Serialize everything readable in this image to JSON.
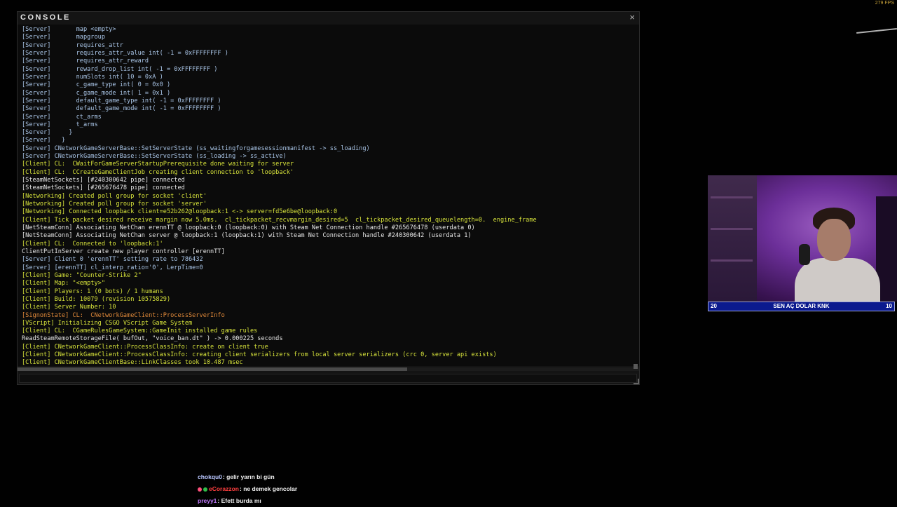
{
  "fps_counter": "279 FPS",
  "console": {
    "title": "CONSOLE",
    "close_glyph": "×",
    "input_value": "",
    "lines": [
      {
        "text": "[Server]       map <empty>",
        "color": "#aac6e8"
      },
      {
        "text": "[Server]       mapgroup",
        "color": "#aac6e8"
      },
      {
        "text": "[Server]       requires_attr",
        "color": "#aac6e8"
      },
      {
        "text": "[Server]       requires_attr_value int( -1 = 0xFFFFFFFF )",
        "color": "#aac6e8"
      },
      {
        "text": "[Server]       requires_attr_reward",
        "color": "#aac6e8"
      },
      {
        "text": "[Server]       reward_drop_list int( -1 = 0xFFFFFFFF )",
        "color": "#aac6e8"
      },
      {
        "text": "[Server]       numSlots int( 10 = 0xA )",
        "color": "#aac6e8"
      },
      {
        "text": "[Server]       c_game_type int( 0 = 0x0 )",
        "color": "#aac6e8"
      },
      {
        "text": "[Server]       c_game_mode int( 1 = 0x1 )",
        "color": "#aac6e8"
      },
      {
        "text": "[Server]       default_game_type int( -1 = 0xFFFFFFFF )",
        "color": "#aac6e8"
      },
      {
        "text": "[Server]       default_game_mode int( -1 = 0xFFFFFFFF )",
        "color": "#aac6e8"
      },
      {
        "text": "[Server]       ct_arms",
        "color": "#aac6e8"
      },
      {
        "text": "[Server]       t_arms",
        "color": "#aac6e8"
      },
      {
        "text": "[Server]     }",
        "color": "#aac6e8"
      },
      {
        "text": "[Server]   }",
        "color": "#aac6e8"
      },
      {
        "text": "[Server] CNetworkGameServerBase::SetServerState (ss_waitingforgamesessionmanifest -> ss_loading)",
        "color": "#aac6e8"
      },
      {
        "text": "[Server] CNetworkGameServerBase::SetServerState (ss_loading -> ss_active)",
        "color": "#aac6e8"
      },
      {
        "text": "[Client] CL:  CWaitForGameServerStartupPrerequisite done waiting for server",
        "color": "#d7e33b"
      },
      {
        "text": "[Client] CL:  CCreateGameClientJob creating client connection to 'loopback'",
        "color": "#d7e33b"
      },
      {
        "text": "[SteamNetSockets] [#240300642 pipe] connected",
        "color": "#e8e8e8"
      },
      {
        "text": "[SteamNetSockets] [#265676478 pipe] connected",
        "color": "#e8e8e8"
      },
      {
        "text": "[Networking] Created poll group for socket 'client'",
        "color": "#d7e33b"
      },
      {
        "text": "[Networking] Created poll group for socket 'server'",
        "color": "#d7e33b"
      },
      {
        "text": "[Networking] Connected loopback client=e52b262@loopback:1 <-> server=fd5e6be@loopback:0",
        "color": "#d7e33b"
      },
      {
        "text": "[Client] Tick packet desired receive margin now 5.0ms.  cl_tickpacket_recvmargin_desired=5  cl_tickpacket_desired_queuelength=0.  engine_frame",
        "color": "#d7e33b"
      },
      {
        "text": "[NetSteamConn] Associating NetChan erennTT @ loopback:0 (loopback:0) with Steam Net Connection handle #265676478 (userdata 0)",
        "color": "#e8e8e8"
      },
      {
        "text": "[NetSteamConn] Associating NetChan server @ loopback:1 (loopback:1) with Steam Net Connection handle #240300642 (userdata 1)",
        "color": "#e8e8e8"
      },
      {
        "text": "[Client] CL:  Connected to 'loopback:1'",
        "color": "#d7e33b"
      },
      {
        "text": "ClientPutInServer create new player controller [erennTT]",
        "color": "#e8e8e8"
      },
      {
        "text": "[Server] Client 0 'erennTT' setting rate to 786432",
        "color": "#aac6e8"
      },
      {
        "text": "[Server] [erennTT] cl_interp_ratio='0', LerpTime=0",
        "color": "#aac6e8"
      },
      {
        "text": "[Client] Game: \"Counter-Strike 2\"",
        "color": "#d7e33b"
      },
      {
        "text": "[Client] Map: \"<empty>\"",
        "color": "#d7e33b"
      },
      {
        "text": "[Client] Players: 1 (0 bots) / 1 humans",
        "color": "#d7e33b"
      },
      {
        "text": "[Client] Build: 10079 (revision 10575829)",
        "color": "#d7e33b"
      },
      {
        "text": "[Client] Server Number: 10",
        "color": "#d7e33b"
      },
      {
        "text": "[SignonState] CL:  CNetworkGameClient::ProcessServerInfo",
        "color": "#e28a3a"
      },
      {
        "text": "[VScript] Initializing CSGO VScript Game System",
        "color": "#d7e33b"
      },
      {
        "text": "[Client] CL:  CGameRulesGameSystem::GameInit installed game rules",
        "color": "#d7e33b"
      },
      {
        "text": "ReadSteamRemoteStorageFile( bufOut, \"voice_ban.dt\" ) -> 0.000225 seconds",
        "color": "#e8e8e8"
      },
      {
        "text": "[Client] CNetworkGameClient::ProcessClassInfo: create on client true",
        "color": "#d7e33b"
      },
      {
        "text": "[Client] CNetworkGameClient::ProcessClassInfo: creating client serializers from local server serializers (crc 0, server api exists)",
        "color": "#d7e33b"
      },
      {
        "text": "[Client] CNetworkGameClientBase::LinkClasses took 10.487 msec",
        "color": "#d7e33b"
      }
    ]
  },
  "sub_goal": {
    "left": "20",
    "label": "SEN AÇ DOLAR KNK",
    "right": "10"
  },
  "chat": [
    {
      "user": "chokqu0",
      "user_color": "#b9c6ff",
      "message": "gelir yarın bi gün",
      "badges": []
    },
    {
      "user": "eCorazzon",
      "user_color": "#ff3f3f",
      "message": "ne demek gencolar",
      "badges": [
        "#ff4f7b",
        "#2fbf4a"
      ]
    },
    {
      "user": "preyy1",
      "user_color": "#c27cff",
      "message": "Efett burda mı",
      "badges": []
    }
  ]
}
